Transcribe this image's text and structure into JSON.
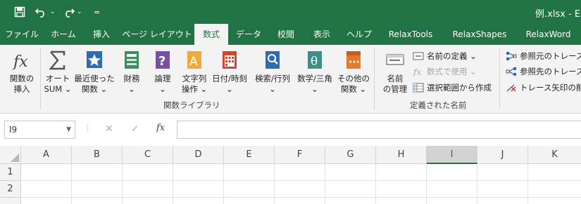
{
  "window": {
    "title": "例.xlsx  -  E",
    "qat_customize": "="
  },
  "tabs": [
    "ファイル",
    "ホーム",
    "挿入",
    "ページ レイアウト",
    "数式",
    "データ",
    "校閲",
    "表示",
    "ヘルプ",
    "RelaxTools",
    "RelaxShapes",
    "RelaxWord"
  ],
  "active_tab_index": 4,
  "ribbon": {
    "group1": {
      "label": "関数ライブラリ",
      "buttons": [
        {
          "line1": "関数の",
          "line2": "挿入",
          "icon": "fx-icon"
        },
        {
          "line1": "オート",
          "line2": "SUM ⌄",
          "icon": "sigma-icon"
        },
        {
          "line1": "最近使った",
          "line2": "関数 ⌄",
          "icon": "star-icon"
        },
        {
          "line1": "財務",
          "line2": "⌄",
          "icon": "finance-icon"
        },
        {
          "line1": "論理",
          "line2": "⌄",
          "icon": "logic-icon"
        },
        {
          "line1": "文字列",
          "line2": "操作 ⌄",
          "icon": "text-icon"
        },
        {
          "line1": "日付/時刻",
          "line2": "⌄",
          "icon": "calendar-icon"
        },
        {
          "line1": "検索/行列",
          "line2": "⌄",
          "icon": "lookup-icon"
        },
        {
          "line1": "数学/三角",
          "line2": "⌄",
          "icon": "math-icon"
        },
        {
          "line1": "その他の",
          "line2": "関数 ⌄",
          "icon": "more-functions-icon"
        }
      ]
    },
    "group2": {
      "label": "定義された名前",
      "name_manager": {
        "line1": "名前",
        "line2": "の管理"
      },
      "define_name": "名前の定義  ⌄",
      "use_in_formula": "数式で使用 ⌄",
      "create_from_selection": "選択範囲から作成"
    },
    "group3": {
      "trace_precedents": "参照元のトレース",
      "trace_dependents": "参照先のトレース",
      "remove_arrows": "トレース矢印の削除"
    }
  },
  "formula_bar": {
    "name_box": "I9",
    "cancel": "✕",
    "enter": "✓",
    "fx": "fx",
    "formula": ""
  },
  "grid": {
    "columns": [
      "A",
      "B",
      "C",
      "D",
      "E",
      "F",
      "G",
      "H",
      "I",
      "J",
      "K"
    ],
    "selected_column": "I",
    "rows": [
      "1",
      "2"
    ]
  },
  "colors": {
    "brand": "#217346",
    "ribbon_bg": "#f3f3f3"
  }
}
